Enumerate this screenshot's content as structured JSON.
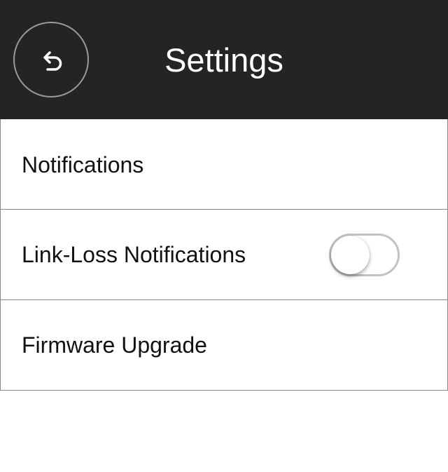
{
  "header": {
    "title": "Settings",
    "back_icon": "back-arrow-icon",
    "background": "#242424"
  },
  "settings": {
    "items": [
      {
        "label": "Notifications"
      },
      {
        "label": "Link-Loss Notifications",
        "toggle_on": false
      },
      {
        "label": "Firmware Upgrade"
      }
    ]
  }
}
